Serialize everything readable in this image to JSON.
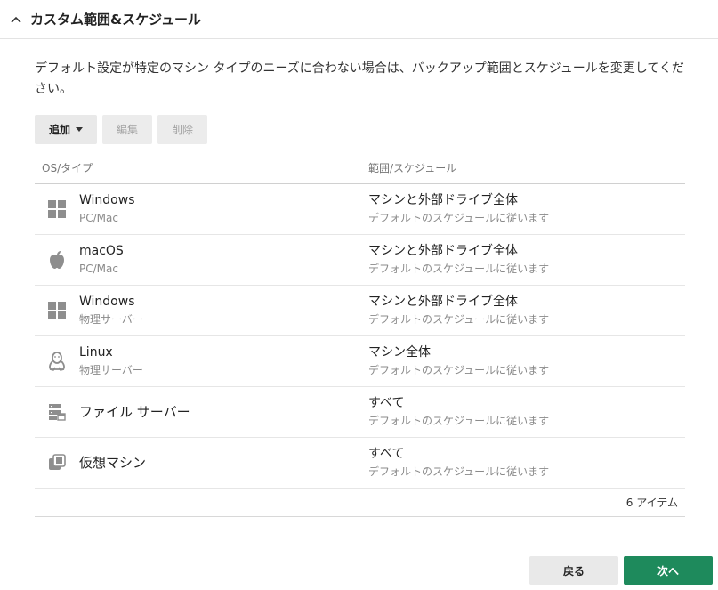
{
  "section": {
    "title": "カスタム範囲&スケジュール",
    "collapse_icon": "chevron-up-icon"
  },
  "description": "デフォルト設定が特定のマシン タイプのニーズに合わない場合は、バックアップ範囲とスケジュールを変更してください。",
  "toolbar": {
    "add_label": "追加",
    "edit_label": "編集",
    "delete_label": "削除"
  },
  "table": {
    "columns": [
      "OS/タイプ",
      "範囲/スケジュール"
    ],
    "rows": [
      {
        "icon": "windows-icon",
        "name": "Windows",
        "type": "PC/Mac",
        "scope": "マシンと外部ドライブ全体",
        "schedule": "デフォルトのスケジュールに従います"
      },
      {
        "icon": "apple-icon",
        "name": "macOS",
        "type": "PC/Mac",
        "scope": "マシンと外部ドライブ全体",
        "schedule": "デフォルトのスケジュールに従います"
      },
      {
        "icon": "windows-icon",
        "name": "Windows",
        "type": "物理サーバー",
        "scope": "マシンと外部ドライブ全体",
        "schedule": "デフォルトのスケジュールに従います"
      },
      {
        "icon": "linux-icon",
        "name": "Linux",
        "type": "物理サーバー",
        "scope": "マシン全体",
        "schedule": "デフォルトのスケジュールに従います"
      },
      {
        "icon": "file-server-icon",
        "name": "ファイル サーバー",
        "type": "",
        "scope": "すべて",
        "schedule": "デフォルトのスケジュールに従います"
      },
      {
        "icon": "virtual-machine-icon",
        "name": "仮想マシン",
        "type": "",
        "scope": "すべて",
        "schedule": "デフォルトのスケジュールに従います"
      }
    ],
    "item_count": "6 アイテム"
  },
  "footer": {
    "back_label": "戻る",
    "next_label": "次へ"
  },
  "colors": {
    "primary_button": "#1e8a5c",
    "icon_gray": "#8e8e8e"
  }
}
